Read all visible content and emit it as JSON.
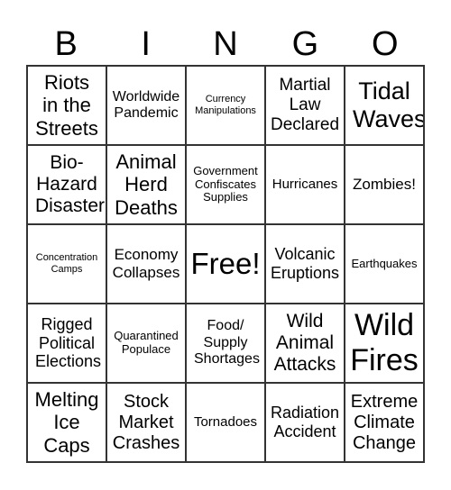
{
  "header": [
    "B",
    "I",
    "N",
    "G",
    "O"
  ],
  "cells": [
    "Riots in the Streets",
    "Worldwide Pandemic",
    "Currency Manipulations",
    "Martial Law Declared",
    "Tidal Waves",
    "Bio-Hazard Disaster",
    "Animal Herd Deaths",
    "Government Confiscates Supplies",
    "Hurricanes",
    "Zombies!",
    "Concentration Camps",
    "Economy Collapses",
    "Free!",
    "Volcanic Eruptions",
    "Earthquakes",
    "Rigged Political Elections",
    "Quarantined Populace",
    "Food/ Supply Shortages",
    "Wild Animal Attacks",
    "Wild Fires",
    "Melting Ice Caps",
    "Stock Market Crashes",
    "Tornadoes",
    "Radiation Accident",
    "Extreme Climate Change"
  ]
}
